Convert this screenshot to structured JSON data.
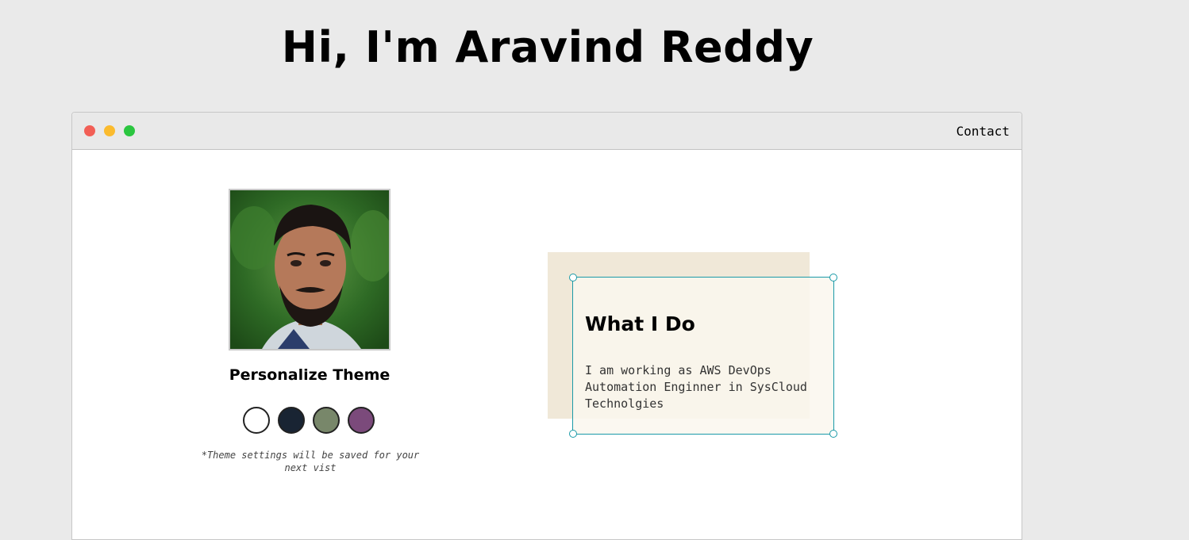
{
  "header": {
    "title": "Hi, I'm Aravind Reddy"
  },
  "window": {
    "controls": [
      {
        "name": "close",
        "color": "#f25f56"
      },
      {
        "name": "minimize",
        "color": "#fbbb2e"
      },
      {
        "name": "maximize",
        "color": "#2bc640"
      }
    ],
    "nav": {
      "contact_label": "Contact"
    }
  },
  "profile": {
    "avatar_icon": "profile-photo",
    "personalize_title": "Personalize Theme",
    "themes": [
      {
        "name": "light",
        "color": "#ffffff"
      },
      {
        "name": "dark-blue",
        "color": "#192433"
      },
      {
        "name": "green",
        "color": "#78876a"
      },
      {
        "name": "purple",
        "color": "#7b4a7b"
      }
    ],
    "theme_note": "*Theme settings will be saved for your next vist"
  },
  "about": {
    "title": "What I Do",
    "body": "I am working as AWS DevOps Automation Enginner in SysCloud Technolgies",
    "accent_color": "#1a9aa8"
  }
}
